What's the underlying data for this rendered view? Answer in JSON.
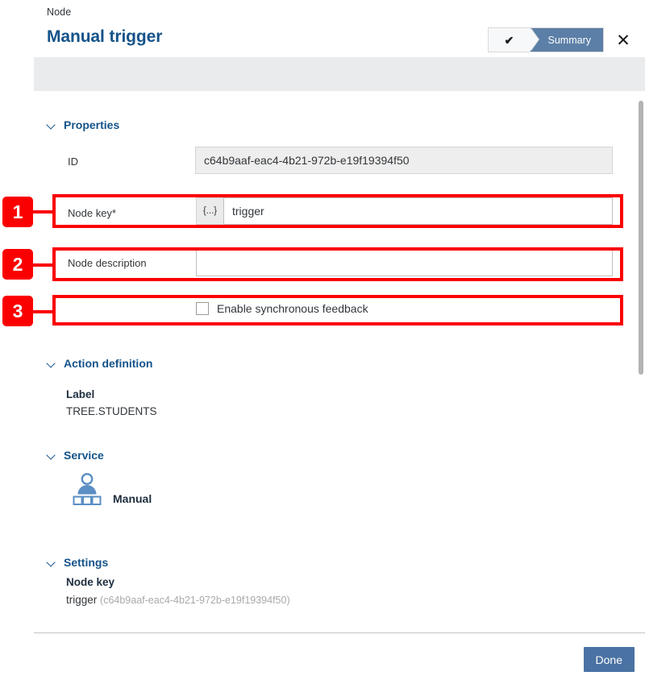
{
  "header": {
    "breadcrumb": "Node",
    "title": "Manual trigger",
    "wizard": {
      "completed_step_icon": "check-icon",
      "completed_step_glyph": "✔",
      "active_step_label": "Summary"
    },
    "close_icon": "close-icon",
    "close_glyph": "✕"
  },
  "sections": {
    "properties": {
      "title": "Properties",
      "id_label": "ID",
      "id_value": "c64b9aaf-eac4-4b21-972b-e19f19394f50",
      "node_key_label": "Node key*",
      "node_key_expression_button": "{...}",
      "node_key_value": "trigger",
      "node_key_placeholder": "",
      "node_description_label": "Node description",
      "node_description_value": "",
      "node_description_placeholder": "",
      "sync_feedback_label": "Enable synchronous feedback",
      "sync_feedback_checked": false
    },
    "action_definition": {
      "title": "Action definition",
      "label_key": "Label",
      "label_value": "TREE.STUDENTS"
    },
    "service": {
      "title": "Service",
      "icon": "manual-user-service-icon",
      "name": "Manual"
    },
    "settings": {
      "title": "Settings",
      "node_key_heading": "Node key",
      "node_key_value": "trigger",
      "node_key_id": "(c64b9aaf-eac4-4b21-972b-e19f19394f50)"
    }
  },
  "footer": {
    "done_label": "Done"
  },
  "annotations": [
    {
      "number": "1"
    },
    {
      "number": "2"
    },
    {
      "number": "3"
    }
  ],
  "colors": {
    "accent_blue": "#14538a",
    "active_step_blue": "#5b7fa6",
    "primary_button_blue": "#4a72a3",
    "annotation_red": "#fb0000",
    "band_gray": "#eaebed"
  }
}
